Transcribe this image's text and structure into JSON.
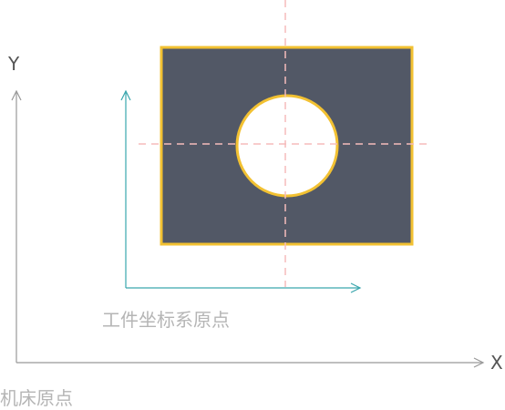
{
  "labels": {
    "machine_y": "Y",
    "machine_x": "X",
    "machine_origin": "机床原点",
    "workpiece_origin": "工件坐标系原点"
  },
  "colors": {
    "machine_axis": "#999999",
    "workpiece_axis": "#3aa6ad",
    "plate_fill": "#525866",
    "plate_border": "#f2c132",
    "hole_fill": "#ffffff",
    "centerline": "#f6bcbc",
    "caption_text": "#b5b5b5",
    "axis_letter": "#555555"
  }
}
